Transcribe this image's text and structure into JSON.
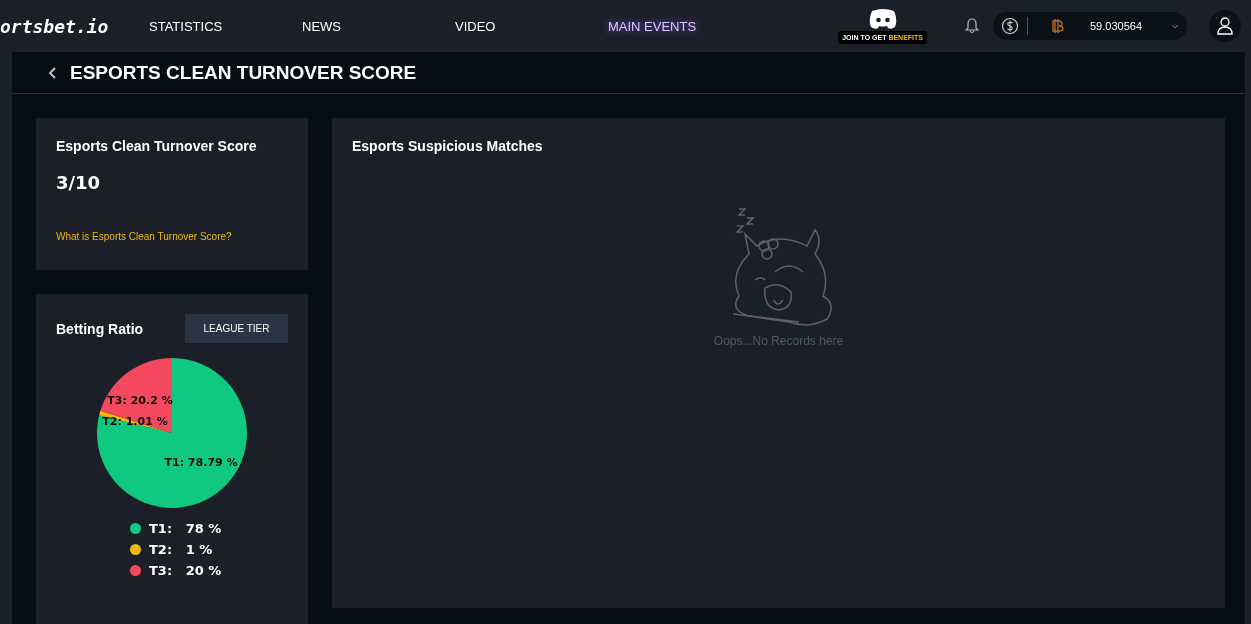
{
  "header": {
    "logo": "ortsbet.io",
    "nav": [
      {
        "label": "STATISTICS",
        "selected": false
      },
      {
        "label": "NEWS",
        "selected": false
      },
      {
        "label": "VIDEO",
        "selected": false
      },
      {
        "label": "MAIN EVENTS",
        "selected": true
      }
    ],
    "discord": {
      "text": "JOIN TO GET ",
      "highlight": "BENEFITS"
    },
    "balance": "59.030564"
  },
  "page_title": "ESPORTS CLEAN TURNOVER SCORE",
  "score_card": {
    "title": "Esports Clean Turnover Score",
    "score": "3/10",
    "link": "What is Esports Clean Turnover Score?"
  },
  "betting_ratio": {
    "title": "Betting Ratio",
    "button": "LEAGUE TIER",
    "chart_data": {
      "type": "pie",
      "values": [
        78.79,
        1.01,
        20.2
      ],
      "colors": [
        "#10c981",
        "#f0b90b",
        "#f4485f"
      ],
      "data_labels": true,
      "value_labels": [
        "T1: 78.79 %",
        "T2: 1.01 %",
        "T3: 20.2 %"
      ]
    },
    "legend": [
      {
        "label": "T1:",
        "value": "78 %",
        "color": "#10c981"
      },
      {
        "label": "T2:",
        "value": "1 %",
        "color": "#f0b90b"
      },
      {
        "label": "T3:",
        "value": "20 %",
        "color": "#f4485f"
      }
    ]
  },
  "suspicious": {
    "title": "Esports Suspicious Matches",
    "empty_text": "Oops...No Records here"
  }
}
